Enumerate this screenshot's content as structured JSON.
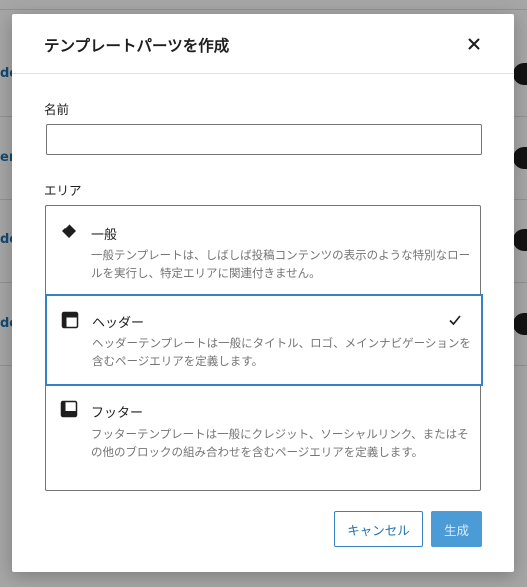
{
  "background": {
    "links": [
      "de",
      "er",
      "de",
      "de"
    ]
  },
  "modal": {
    "title": "テンプレートパーツを作成",
    "close_icon": "close-icon"
  },
  "form": {
    "name_label": "名前",
    "name_value": "",
    "name_placeholder": "",
    "area_label": "エリア"
  },
  "areas": [
    {
      "icon": "general-diamond-icon",
      "title": "一般",
      "description": "一般テンプレートは、しばしば投稿コンテンツの表示のような特別なロールを実行し、特定エリアに関連付きません。",
      "selected": false
    },
    {
      "icon": "header-layout-icon",
      "title": "ヘッダー",
      "description": "ヘッダーテンプレートは一般にタイトル、ロゴ、メインナビゲーションを含むページエリアを定義します。",
      "selected": true
    },
    {
      "icon": "footer-layout-icon",
      "title": "フッター",
      "description": "フッターテンプレートは一般にクレジット、ソーシャルリンク、またはその他のブロックの組み合わせを含むページエリアを定義します。",
      "selected": false
    }
  ],
  "buttons": {
    "cancel": "キャンセル",
    "create": "生成"
  },
  "colors": {
    "accent": "#3582c4",
    "link": "#2271b1",
    "primary_disabled": "#4b9bd6"
  }
}
